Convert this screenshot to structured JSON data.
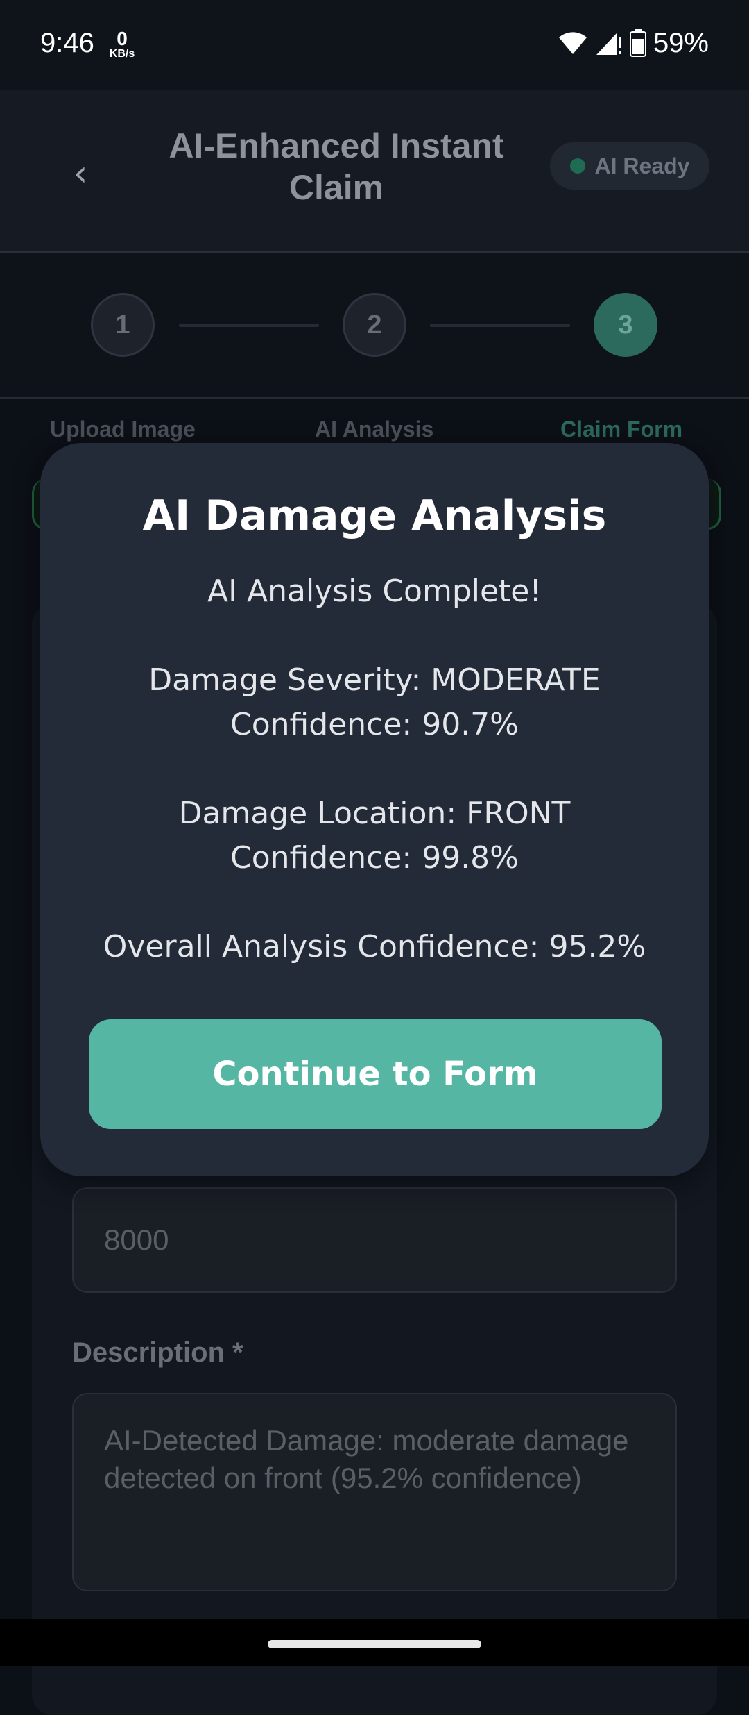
{
  "status_bar": {
    "time": "9:46",
    "kb_value": "0",
    "kb_unit": "KB/s",
    "battery": "59%"
  },
  "header": {
    "back_icon": "chevron-left-icon",
    "title": "AI-Enhanced Instant Claim",
    "ai_status": "AI Ready",
    "ai_status_color": "#1f6b54"
  },
  "stepper": {
    "steps": [
      "1",
      "2",
      "3"
    ],
    "labels": [
      "Upload Image",
      "AI Analysis",
      "Claim Form"
    ],
    "active_index": 2
  },
  "form": {
    "amount_value": "8000",
    "description_label": "Description *",
    "description_value": "AI-Detected Damage: moderate damage detected on front (95.2% confidence)"
  },
  "modal": {
    "title": "AI Damage Analysis",
    "subtitle": "AI Analysis Complete!",
    "severity_line": "Damage Severity: MODERATE",
    "severity_confidence": "Confidence: 90.7%",
    "location_line": "Damage Location: FRONT",
    "location_confidence": "Confidence: 99.8%",
    "overall_line": "Overall Analysis Confidence: 95.2%",
    "continue_label": "Continue to Form",
    "accent_color": "#56b6a4"
  }
}
